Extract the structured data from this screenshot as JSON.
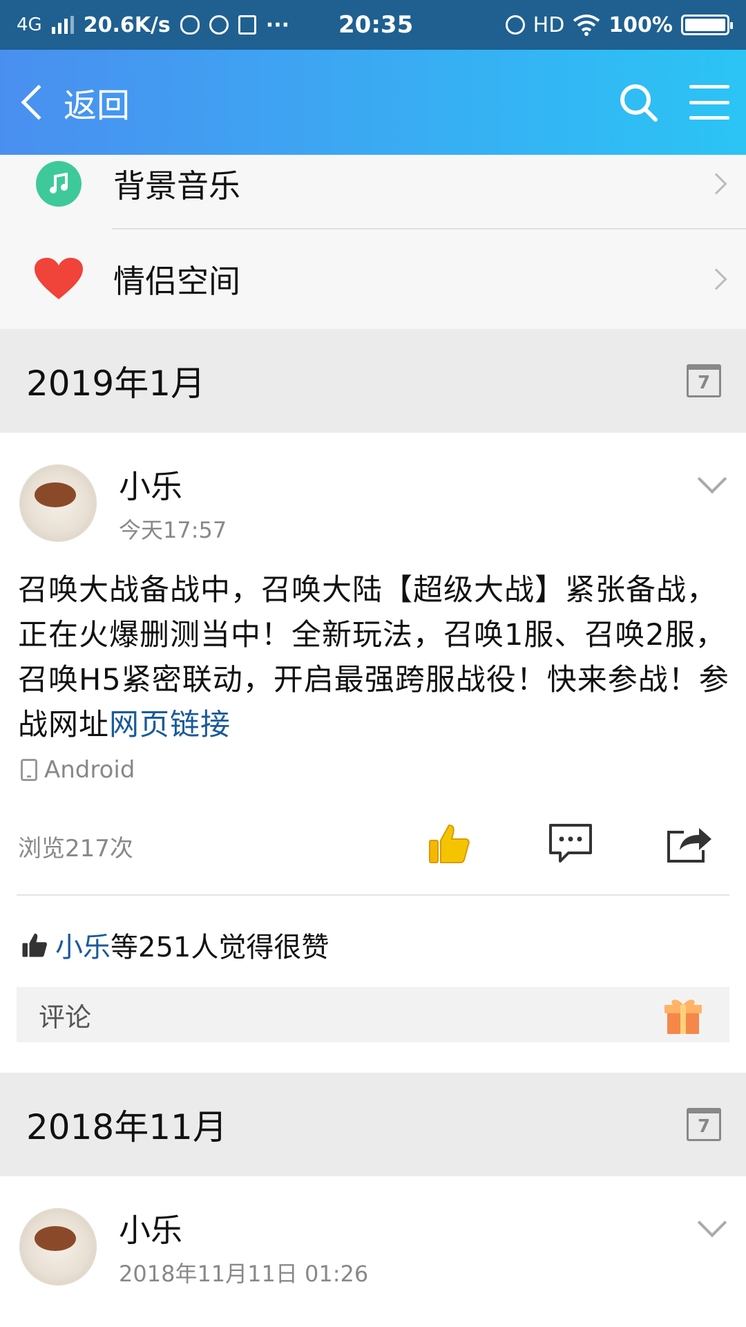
{
  "status_bar": {
    "network": "4G",
    "speed": "20.6K/s",
    "dots": "···",
    "time": "20:35",
    "hd": "HD",
    "battery": "100%"
  },
  "nav": {
    "back_label": "返回",
    "icons": [
      "search-icon",
      "menu-icon"
    ]
  },
  "menu": {
    "items": [
      {
        "label": "背景音乐",
        "icon": "music-icon"
      },
      {
        "label": "情侣空间",
        "icon": "heart-icon"
      }
    ]
  },
  "sections": [
    {
      "month": "2019年1月",
      "post": {
        "name": "小乐",
        "time": "今天17:57",
        "text": "召唤大战备战中，召唤大陆【超级大战】紧张备战，正在火爆删测当中！全新玩法，召唤1服、召唤2服，召唤H5紧密联动，开启最强跨服战役！快来参战！参战网址",
        "link": "网页链接",
        "device": "Android",
        "views": "浏览217次",
        "likes_name": "小乐",
        "likes_suffix": "等251人觉得很赞",
        "comment_placeholder": "评论"
      }
    },
    {
      "month": "2018年11月",
      "post": {
        "name": "小乐",
        "time": "2018年11月11日 01:26"
      }
    }
  ],
  "colors": {
    "nav_start": "#4a8ff0",
    "nav_end": "#2bc4f5",
    "status_bg": "#1f6091",
    "link": "#1a5a9c",
    "like_icon": "#f5b800",
    "music_green": "#3ec99b",
    "heart_red": "#f0433a"
  }
}
